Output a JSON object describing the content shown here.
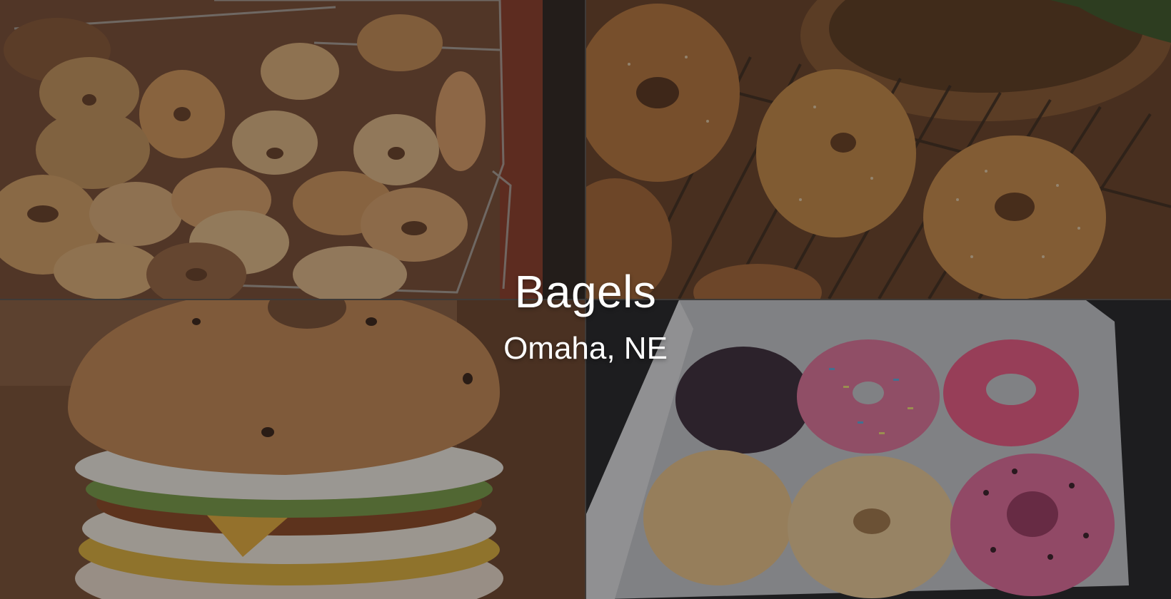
{
  "hero": {
    "title": "Bagels",
    "subtitle": "Omaha, NE"
  },
  "images": [
    {
      "name": "bagel-basket-photo",
      "subject": "bagels in wire baskets"
    },
    {
      "name": "seasoned-bagels-photo",
      "subject": "seasoned bagels on cooling rack"
    },
    {
      "name": "bagel-sandwich-photo",
      "subject": "breakfast bagel sandwich"
    },
    {
      "name": "donut-box-photo",
      "subject": "box of donuts"
    }
  ],
  "colors": {
    "overlay": "#141212",
    "text": "#ffffff"
  }
}
